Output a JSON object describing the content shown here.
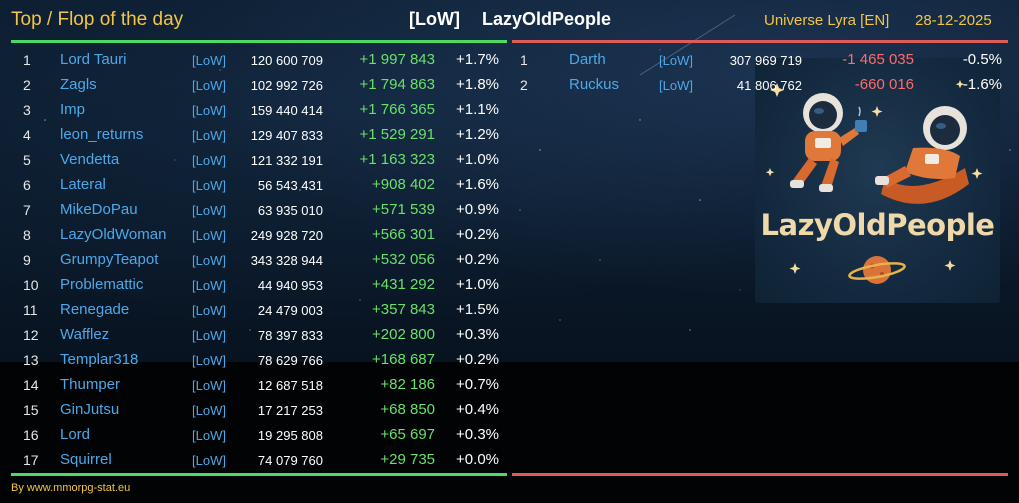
{
  "header": {
    "title": "Top / Flop of the day",
    "guild_tag": "[LoW]",
    "guild_name": "LazyOldPeople",
    "universe": "Universe Lyra [EN]",
    "date": "28-12-2025"
  },
  "colors": {
    "accent_gold": "#f4c542",
    "name_blue": "#4ea8e8",
    "positive_green": "#6be06b",
    "negative_red": "#ff6b6b",
    "top_divider": "#4cd964",
    "flop_divider": "#e05a5a"
  },
  "top": [
    {
      "rank": "1",
      "name": "Lord Tauri",
      "tag": "[LoW]",
      "score": "120 600 709",
      "delta": "+1 997 843",
      "pct": "+1.7%"
    },
    {
      "rank": "2",
      "name": "Zagls",
      "tag": "[LoW]",
      "score": "102 992 726",
      "delta": "+1 794 863",
      "pct": "+1.8%"
    },
    {
      "rank": "3",
      "name": "Imp",
      "tag": "[LoW]",
      "score": "159 440 414",
      "delta": "+1 766 365",
      "pct": "+1.1%"
    },
    {
      "rank": "4",
      "name": "leon_returns",
      "tag": "[LoW]",
      "score": "129 407 833",
      "delta": "+1 529 291",
      "pct": "+1.2%"
    },
    {
      "rank": "5",
      "name": "Vendetta",
      "tag": "[LoW]",
      "score": "121 332 191",
      "delta": "+1 163 323",
      "pct": "+1.0%"
    },
    {
      "rank": "6",
      "name": "Lateral",
      "tag": "[LoW]",
      "score": "56 543 431",
      "delta": "+908 402",
      "pct": "+1.6%"
    },
    {
      "rank": "7",
      "name": "MikeDoPau",
      "tag": "[LoW]",
      "score": "63 935 010",
      "delta": "+571 539",
      "pct": "+0.9%"
    },
    {
      "rank": "8",
      "name": "LazyOldWoman",
      "tag": "[LoW]",
      "score": "249 928 720",
      "delta": "+566 301",
      "pct": "+0.2%"
    },
    {
      "rank": "9",
      "name": "GrumpyTeapot",
      "tag": "[LoW]",
      "score": "343 328 944",
      "delta": "+532 056",
      "pct": "+0.2%"
    },
    {
      "rank": "10",
      "name": "Problemattic",
      "tag": "[LoW]",
      "score": "44 940 953",
      "delta": "+431 292",
      "pct": "+1.0%"
    },
    {
      "rank": "11",
      "name": "Renegade",
      "tag": "[LoW]",
      "score": "24 479 003",
      "delta": "+357 843",
      "pct": "+1.5%"
    },
    {
      "rank": "12",
      "name": "Wafflez",
      "tag": "[LoW]",
      "score": "78 397 833",
      "delta": "+202 800",
      "pct": "+0.3%"
    },
    {
      "rank": "13",
      "name": "Templar318",
      "tag": "[LoW]",
      "score": "78 629 766",
      "delta": "+168 687",
      "pct": "+0.2%"
    },
    {
      "rank": "14",
      "name": "Thumper",
      "tag": "[LoW]",
      "score": "12 687 518",
      "delta": "+82 186",
      "pct": "+0.7%"
    },
    {
      "rank": "15",
      "name": "GinJutsu",
      "tag": "[LoW]",
      "score": "17 217 253",
      "delta": "+68 850",
      "pct": "+0.4%"
    },
    {
      "rank": "16",
      "name": "Lord",
      "tag": "[LoW]",
      "score": "19 295 808",
      "delta": "+65 697",
      "pct": "+0.3%"
    },
    {
      "rank": "17",
      "name": "Squirrel",
      "tag": "[LoW]",
      "score": "74 079 760",
      "delta": "+29 735",
      "pct": "+0.0%"
    }
  ],
  "flop": [
    {
      "rank": "1",
      "name": "Darth",
      "tag": "[LoW]",
      "score": "307 969 719",
      "delta": "-1 465 035",
      "pct": "-0.5%"
    },
    {
      "rank": "2",
      "name": "Ruckus",
      "tag": "[LoW]",
      "score": "41 806 762",
      "delta": "-660 016",
      "pct": "-1.6%"
    }
  ],
  "logo": {
    "text": "LazyOldPeople"
  },
  "footer": {
    "credit": "By www.mmorpg-stat.eu"
  }
}
